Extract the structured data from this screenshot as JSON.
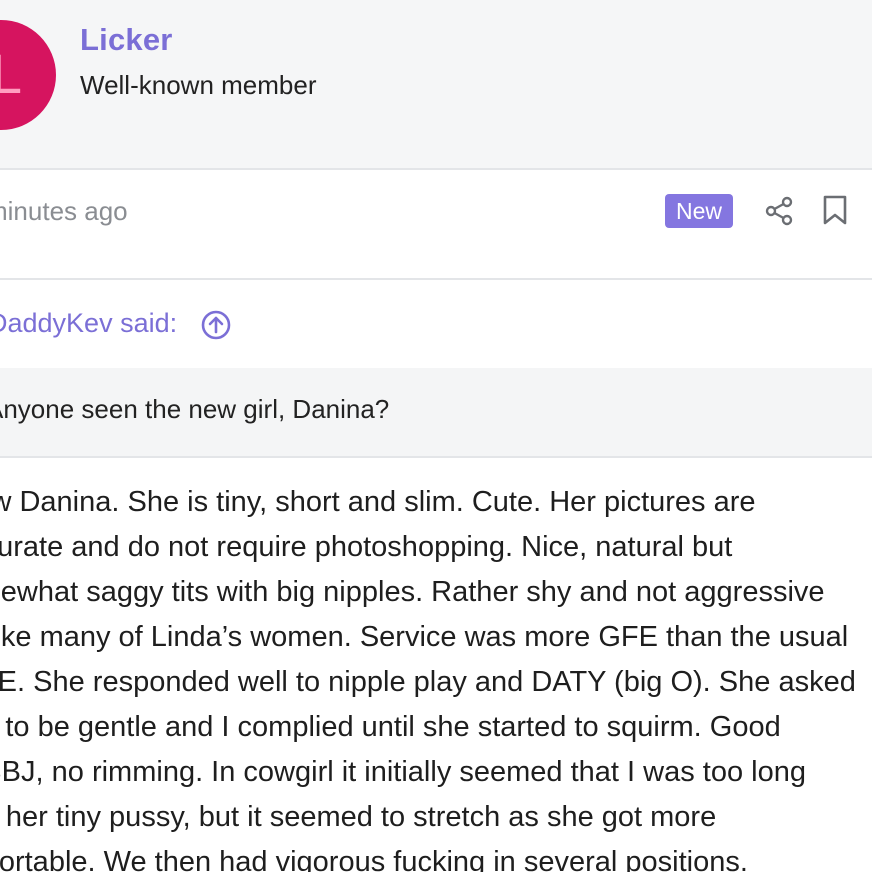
{
  "user": {
    "avatar_letter": "L",
    "name": "Licker",
    "title": "Well-known member",
    "avatar_color": "#d6145f"
  },
  "meta": {
    "time": "minutes ago",
    "badge": "New",
    "share_icon": "share-icon",
    "bookmark_icon": "bookmark-icon",
    "accent_color": "#7b6fd6"
  },
  "quote": {
    "author": "DaddyKev said:",
    "up_icon": "arrow-up-circle-icon",
    "text": "Anyone seen the new girl, Danina?"
  },
  "post": {
    "lines": [
      "Saw Danina. She is tiny, short and slim. Cute. Her pictures are",
      "accurate and do not require photoshopping. Nice, natural but",
      "somewhat saggy tits with big nipples. Rather shy and not aggressive",
      "like many of Linda’s women. Service was more GFE than the usual",
      "PSE. She responded well to nipple play and DATY (big O). She asked",
      "me to be gentle and I complied until she started to squirm. Good",
      "BBBJ, no rimming. In cowgirl it initially seemed that I was too long",
      "for her tiny pussy, but it seemed to stretch as she got more",
      "comfortable. We then had vigorous fucking in several positions."
    ]
  }
}
